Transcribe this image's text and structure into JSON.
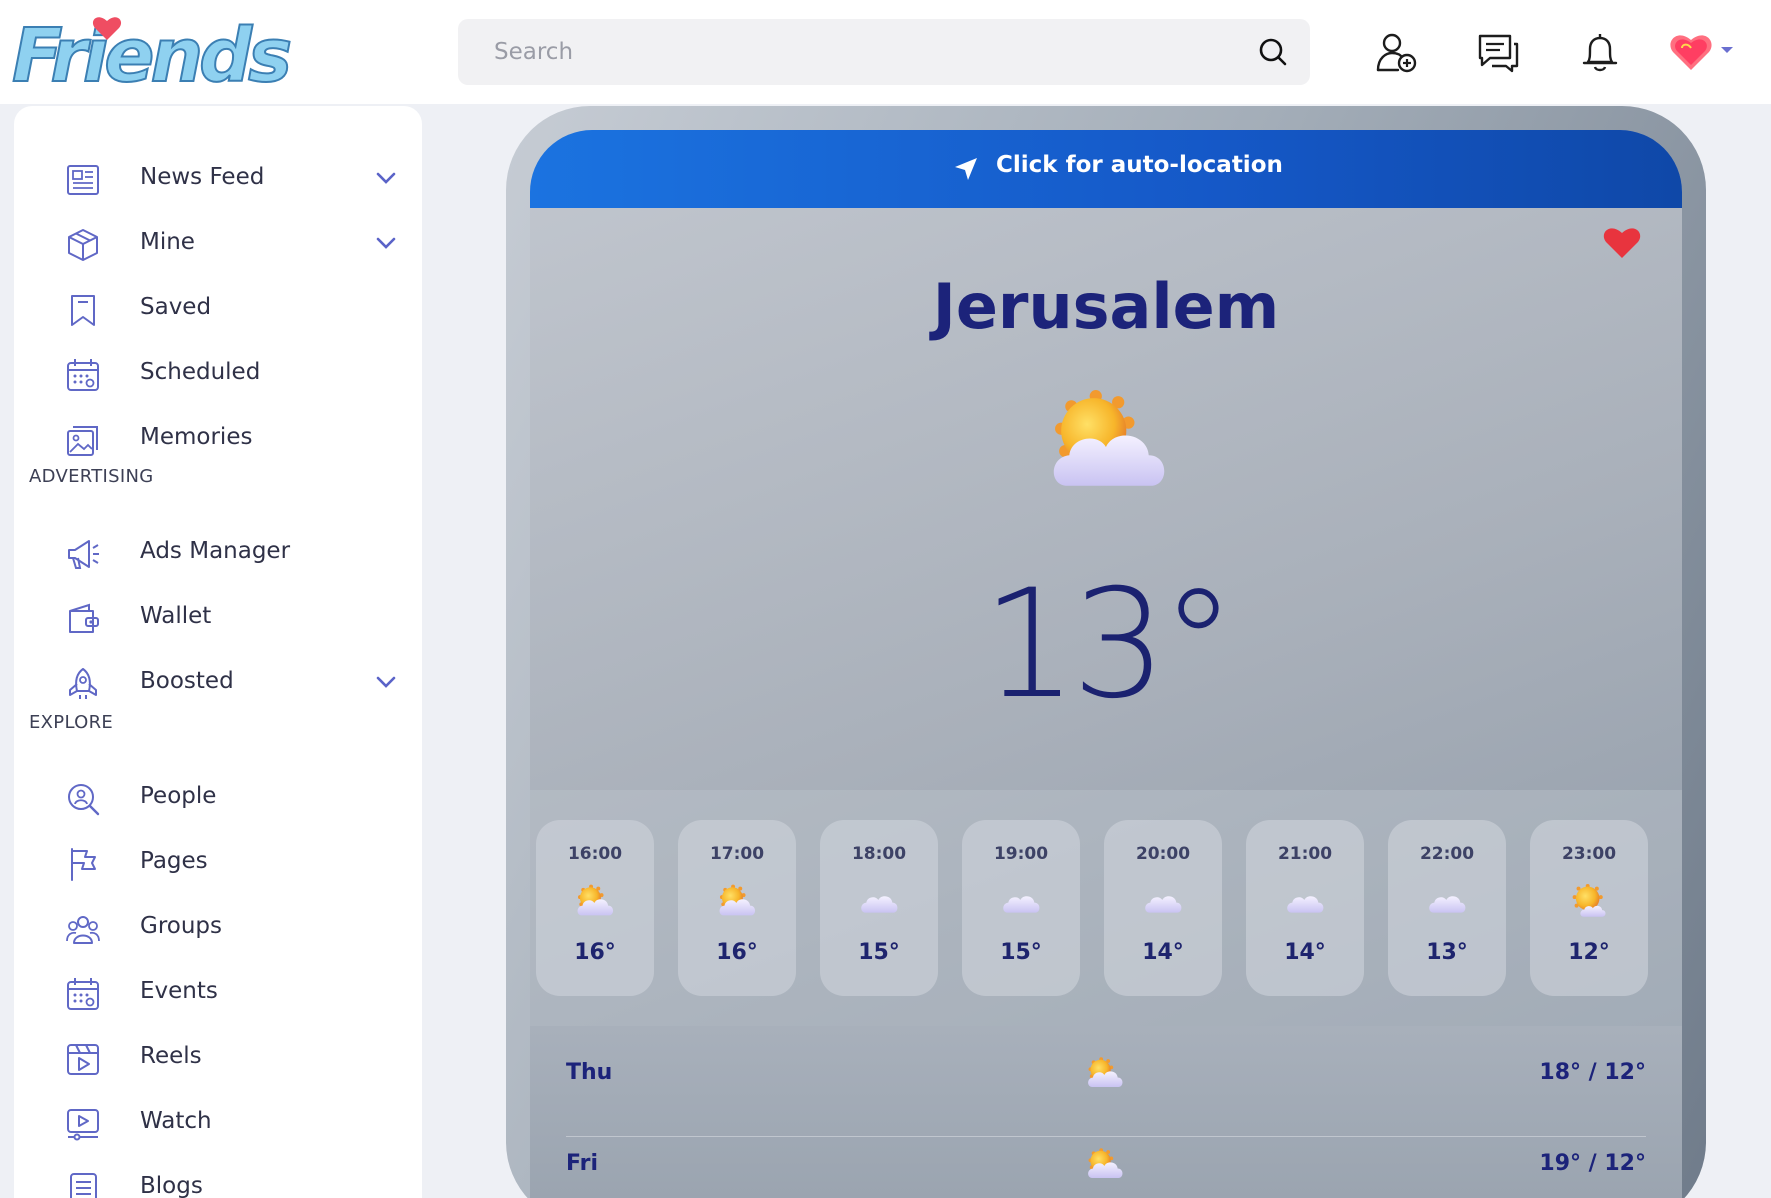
{
  "app": {
    "name": "Friends"
  },
  "search": {
    "placeholder": "Search"
  },
  "sidebar": {
    "items": [
      {
        "label": "News Feed",
        "icon": "newspaper-icon",
        "expandable": true
      },
      {
        "label": "Mine",
        "icon": "box-icon",
        "expandable": true
      },
      {
        "label": "Saved",
        "icon": "bookmark-icon",
        "expandable": false
      },
      {
        "label": "Scheduled",
        "icon": "calendar-icon",
        "expandable": false
      },
      {
        "label": "Memories",
        "icon": "photos-icon",
        "expandable": false
      }
    ],
    "advertising_title": "ADVERTISING",
    "advertising": [
      {
        "label": "Ads Manager",
        "icon": "megaphone-icon",
        "expandable": false
      },
      {
        "label": "Wallet",
        "icon": "wallet-icon",
        "expandable": false
      },
      {
        "label": "Boosted",
        "icon": "rocket-icon",
        "expandable": true
      }
    ],
    "explore_title": "EXPLORE",
    "explore": [
      {
        "label": "People",
        "icon": "people-search-icon"
      },
      {
        "label": "Pages",
        "icon": "flag-icon"
      },
      {
        "label": "Groups",
        "icon": "groups-icon"
      },
      {
        "label": "Events",
        "icon": "calendar-icon"
      },
      {
        "label": "Reels",
        "icon": "reels-icon"
      },
      {
        "label": "Watch",
        "icon": "video-icon"
      },
      {
        "label": "Blogs",
        "icon": "document-icon"
      }
    ]
  },
  "weather": {
    "location_button": "Click for auto-location",
    "city": "Jerusalem",
    "current_temp": "13°",
    "current_condition_icon": "partly-cloudy-icon",
    "hourly": [
      {
        "time": "16:00",
        "temp": "16°",
        "icon": "partly-cloudy-icon"
      },
      {
        "time": "17:00",
        "temp": "16°",
        "icon": "partly-cloudy-icon"
      },
      {
        "time": "18:00",
        "temp": "15°",
        "icon": "cloud-icon"
      },
      {
        "time": "19:00",
        "temp": "15°",
        "icon": "cloud-icon"
      },
      {
        "time": "20:00",
        "temp": "14°",
        "icon": "cloud-icon"
      },
      {
        "time": "21:00",
        "temp": "14°",
        "icon": "cloud-icon"
      },
      {
        "time": "22:00",
        "temp": "13°",
        "icon": "cloud-icon"
      },
      {
        "time": "23:00",
        "temp": "12°",
        "icon": "sun-cloud-icon"
      }
    ],
    "daily": [
      {
        "day": "Thu",
        "range": "18° / 12°",
        "icon": "partly-cloudy-icon"
      },
      {
        "day": "Fri",
        "range": "19° / 12°",
        "icon": "partly-cloudy-icon"
      }
    ]
  },
  "colors": {
    "accent": "#5a63c8",
    "location_bar": "#1b73e0",
    "city_text": "#1c237a",
    "favorite": "#e8343e"
  }
}
